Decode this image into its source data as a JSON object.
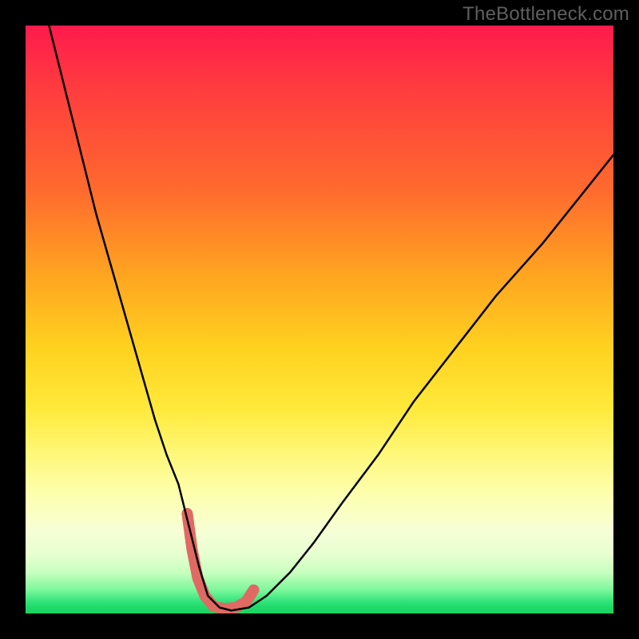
{
  "watermark": "TheBottleneck.com",
  "chart_data": {
    "type": "line",
    "title": "",
    "xlabel": "",
    "ylabel": "",
    "xlim": [
      0,
      100
    ],
    "ylim": [
      0,
      100
    ],
    "grid": false,
    "axis_visible": false,
    "series": [
      {
        "name": "bottleneck-curve",
        "x": [
          4,
          6,
          8,
          10,
          12,
          14,
          16,
          18,
          20,
          22,
          24,
          26,
          28,
          29.5,
          31,
          33,
          35,
          38,
          41,
          45,
          49,
          54,
          60,
          66,
          73,
          80,
          88,
          96,
          100
        ],
        "y": [
          100,
          92,
          84,
          76,
          68,
          61,
          54,
          47,
          40,
          33,
          27,
          22,
          14,
          8,
          3,
          1,
          0.5,
          1,
          3,
          7,
          12,
          19,
          27,
          36,
          45,
          54,
          63,
          73,
          78
        ]
      }
    ],
    "highlight_segment": {
      "name": "minimum-band",
      "x": [
        27.5,
        28.3,
        29.3,
        30.5,
        32,
        33.8,
        35.8,
        37.5,
        38.8
      ],
      "y": [
        17,
        11,
        6,
        3,
        1.2,
        0.8,
        1,
        2,
        4
      ]
    },
    "background_gradient": {
      "direction": "vertical",
      "stops": [
        {
          "pos": 0.0,
          "color": "#ff1a4d"
        },
        {
          "pos": 0.28,
          "color": "#ff6a2e"
        },
        {
          "pos": 0.55,
          "color": "#ffd21f"
        },
        {
          "pos": 0.8,
          "color": "#fdffb0"
        },
        {
          "pos": 0.93,
          "color": "#c8ffbf"
        },
        {
          "pos": 1.0,
          "color": "#19d45f"
        }
      ]
    }
  }
}
